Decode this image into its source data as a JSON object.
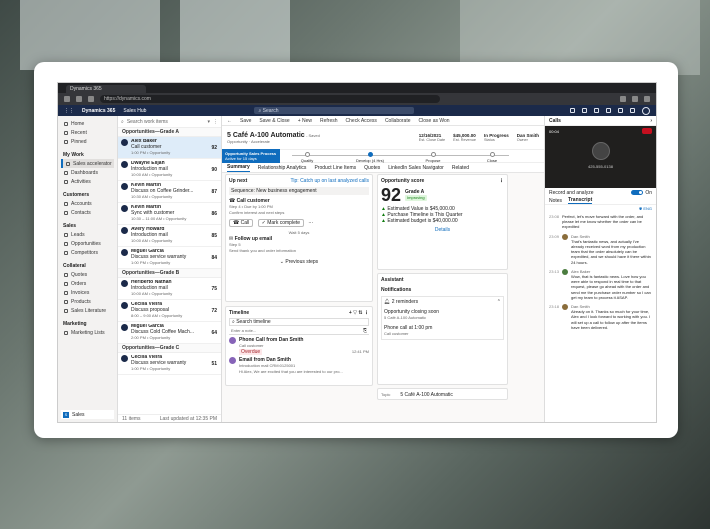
{
  "browser": {
    "tab_title": "Dynamics 365",
    "url": "https://dynamics.com"
  },
  "app": {
    "brand": "Dynamics 365",
    "area": "Sales Hub",
    "search_placeholder": "Search"
  },
  "nav": {
    "top": [
      {
        "label": "Home"
      },
      {
        "label": "Recent"
      },
      {
        "label": "Pinned"
      }
    ],
    "groups": [
      {
        "title": "My Work",
        "items": [
          {
            "label": "Sales accelerator",
            "active": true
          },
          {
            "label": "Dashboards"
          },
          {
            "label": "Activities"
          }
        ]
      },
      {
        "title": "Customers",
        "items": [
          {
            "label": "Accounts"
          },
          {
            "label": "Contacts"
          }
        ]
      },
      {
        "title": "Sales",
        "items": [
          {
            "label": "Leads"
          },
          {
            "label": "Opportunities"
          },
          {
            "label": "Competitors"
          }
        ]
      },
      {
        "title": "Collateral",
        "items": [
          {
            "label": "Quotes"
          },
          {
            "label": "Orders"
          },
          {
            "label": "Invoices"
          },
          {
            "label": "Products"
          },
          {
            "label": "Sales Literature"
          }
        ]
      },
      {
        "title": "Marketing",
        "items": [
          {
            "label": "Marketing Lists"
          }
        ]
      }
    ],
    "footer": {
      "badge": "S",
      "label": "Sales"
    }
  },
  "worklist": {
    "search_placeholder": "Search work items",
    "groups": [
      {
        "title": "Opportunities—Grade A",
        "items": [
          {
            "name": "Alex Baker",
            "task": "Call customer",
            "sub": "1:00 PM • Opportunity",
            "score": "92",
            "selected": true
          },
          {
            "name": "Dwayne Elijah",
            "task": "Introduction mail",
            "sub": "10:00 AM • Opportunity",
            "score": "90"
          },
          {
            "name": "Kevin Martin",
            "task": "Discuss on Coffee Grinder...",
            "sub": "10:30 AM • Opportunity",
            "score": "87"
          },
          {
            "name": "Kevin Martin",
            "task": "Sync with customer",
            "sub": "10:30 – 11:00 AM • Opportunity",
            "score": "86"
          },
          {
            "name": "Avery Howard",
            "task": "Introduction mail",
            "sub": "10:00 AM • Opportunity",
            "score": "85"
          },
          {
            "name": "Miguel Garcia",
            "task": "Discuss service warranty",
            "sub": "1:00 PM • Opportunity",
            "score": "84"
          }
        ]
      },
      {
        "title": "Opportunities—Grade B",
        "items": [
          {
            "name": "Heriberto Nathan",
            "task": "Introduction mail",
            "sub": "10:00 AM • Opportunity",
            "score": "75"
          },
          {
            "name": "Cecilia Vieira",
            "task": "Discuss proposal",
            "sub": "8:00 – 9:00 AM • Opportunity",
            "score": "72"
          },
          {
            "name": "Miguel Garcia",
            "task": "Discuss Cold Coffee Mach...",
            "sub": "2:00 PM • Opportunity",
            "score": "64"
          }
        ]
      },
      {
        "title": "Opportunities—Grade C",
        "items": [
          {
            "name": "Cecilia Vieira",
            "task": "Discuss service warranty",
            "sub": "1:00 PM • Opportunity",
            "score": "51"
          }
        ]
      }
    ],
    "footer_count": "11 items",
    "footer_updated": "Last updated at 12:35 PM"
  },
  "commands": [
    "Save",
    "Save & Close",
    "+ New",
    "Refresh",
    "Check Access",
    "Collaborate",
    "Close as Won"
  ],
  "record": {
    "title": "5 Café A-100 Automatic",
    "saved": "- Saved",
    "subtitle": "Opportunity · Accelerate",
    "meta": [
      {
        "value": "12/16/2021",
        "label": "Est. Close Date"
      },
      {
        "value": "$45,000.00",
        "label": "Est. Revenue"
      },
      {
        "value": "In Progress",
        "label": "Status"
      },
      {
        "value": "Dan Smith",
        "label": "Owner"
      }
    ]
  },
  "bpf": {
    "active_title": "Opportunity Sales Process",
    "active_sub": "Active for 15 days",
    "stages": [
      {
        "label": "Qualify",
        "current": false
      },
      {
        "label": "Develop (4 Hrs)",
        "current": true
      },
      {
        "label": "Propose",
        "current": false
      },
      {
        "label": "Close",
        "current": false
      }
    ]
  },
  "tabs": [
    {
      "label": "Summary",
      "active": true
    },
    {
      "label": "Relationship Analytics"
    },
    {
      "label": "Product Line Items"
    },
    {
      "label": "Quotes"
    },
    {
      "label": "LinkedIn Sales Navigator"
    },
    {
      "label": "Related"
    }
  ],
  "upnext": {
    "title": "Up next",
    "tip": "Tip: Catch up on last analyzed calls",
    "sequence": "Sequence: New business engagement",
    "task_title": "Call customer",
    "task_sub": "Step 4 • Due by 1:00 PM",
    "task_desc": "Confirm interest and next steps",
    "call_btn": "Call",
    "complete_btn": "Mark complete",
    "waiting": "Wait 5 days",
    "next_title": "Follow up email",
    "next_sub": "Step 5",
    "next_desc": "Send thank you and order information",
    "prev": "Previous steps"
  },
  "score": {
    "title": "Opportunity score",
    "value": "92",
    "grade": "Grade A",
    "trend": "Improving",
    "factors": [
      "Estimated Value is $45,000.00",
      "Purchase Timeline is This Quarter",
      "Estimated budget is $40,000.00"
    ],
    "details": "Details"
  },
  "assistant": {
    "title": "Assistant",
    "notifications": "Notifications",
    "reminders": "2 reminders",
    "items": [
      {
        "title": "Opportunity closing soon",
        "sub": "5 Café A-100 Automatic"
      },
      {
        "title": "Phone call at 1:00 pm",
        "sub": "Call customer"
      }
    ]
  },
  "timeline": {
    "title": "Timeline",
    "search": "Search timeline",
    "note": "Enter a note...",
    "entries": [
      {
        "title": "Phone Call from Dan Smith",
        "sub": "Call customer",
        "badge": "Overdue",
        "time": "12:41 PM"
      },
      {
        "title": "Email from Dan Smith",
        "sub": "Introduction mail CRM:0125001",
        "desc": "Hi Alex, We are excited that you are interested to our pro..."
      }
    ]
  },
  "topic": {
    "label": "Topic",
    "value": "5 Café A-100 Automatic"
  },
  "calls": {
    "title": "Calls",
    "timer": "00:04",
    "number": "425-555-0138",
    "record_label": "Record and analyze",
    "record_state": "On",
    "subtabs": [
      {
        "label": "Notes"
      },
      {
        "label": "Transcript",
        "active": true
      }
    ],
    "lang": "ENG",
    "messages": [
      {
        "time": "23:08",
        "speaker": "",
        "text": "Perfect, let's move forward with the order, and please let me know whether the order can be expedited"
      },
      {
        "time": "23:09",
        "speaker": "Dan Smith",
        "text": "That's fantastic news, and actually I've already received word from my production team that the order absolutely can be expedited, and we should have it there within 24 hours."
      },
      {
        "time": "23:13",
        "speaker": "Alex Baker",
        "text": "Wow, that is fantastic news. Love how you were able to respond in real time to that request, please go ahead with the order and send me the purchase order number so I can get my team to process it ASAP."
      },
      {
        "time": "23:18",
        "speaker": "Dan Smith",
        "text": "Already on it. Thanks so much for your time, Alex and I look forward to working with you. I will set up a call to follow up after the items have been delivered."
      }
    ]
  }
}
